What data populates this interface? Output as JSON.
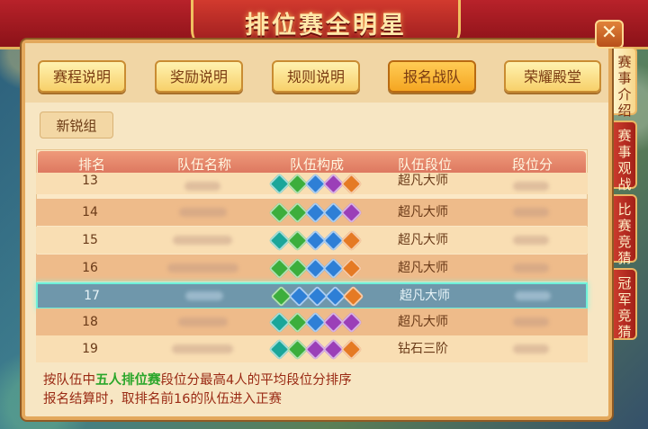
{
  "window": {
    "title": "排位赛全明星",
    "close_label": "✕"
  },
  "tabs": [
    {
      "label": "赛程说明",
      "active": false
    },
    {
      "label": "奖励说明",
      "active": false
    },
    {
      "label": "规则说明",
      "active": false
    },
    {
      "label": "报名战队",
      "active": true
    },
    {
      "label": "荣耀殿堂",
      "active": false
    }
  ],
  "group_button": "新锐组",
  "side_tabs": [
    {
      "label": "赛事介绍",
      "active": true
    },
    {
      "label": "赛事观战",
      "active": false
    },
    {
      "label": "比赛竞猜",
      "active": false
    },
    {
      "label": "冠军竞猜",
      "active": false
    }
  ],
  "table": {
    "headers": [
      "排名",
      "队伍名称",
      "队伍构成",
      "队伍段位",
      "段位分"
    ],
    "rows": [
      {
        "rank": "13",
        "tier": "超凡大师",
        "heroes": [
          "teal",
          "green",
          "blue",
          "purple",
          "orange"
        ],
        "selected": false
      },
      {
        "rank": "14",
        "tier": "超凡大师",
        "heroes": [
          "green",
          "green",
          "blue",
          "blue",
          "purple"
        ],
        "selected": false
      },
      {
        "rank": "15",
        "tier": "超凡大师",
        "heroes": [
          "teal",
          "green",
          "blue",
          "blue",
          "orange"
        ],
        "selected": false
      },
      {
        "rank": "16",
        "tier": "超凡大师",
        "heroes": [
          "green",
          "green",
          "blue",
          "blue",
          "orange"
        ],
        "selected": false
      },
      {
        "rank": "17",
        "tier": "超凡大师",
        "heroes": [
          "green",
          "blue",
          "blue",
          "blue",
          "orange"
        ],
        "selected": true
      },
      {
        "rank": "18",
        "tier": "超凡大师",
        "heroes": [
          "teal",
          "green",
          "blue",
          "purple",
          "purple"
        ],
        "selected": false
      },
      {
        "rank": "19",
        "tier": "钻石三阶",
        "heroes": [
          "teal",
          "green",
          "purple",
          "purple",
          "orange"
        ],
        "selected": false
      }
    ]
  },
  "notes": {
    "line1_pre": "按队伍中",
    "line1_highlight": "五人排位赛",
    "line1_post": "段位分最高4人的平均段位分排序",
    "line2": "报名结算时，取排名前16的队伍进入正赛"
  },
  "colors": {
    "accent": "#f5a622",
    "banner": "#b8222a",
    "selected_row": "#6f97ab",
    "highlight_text": "#2aa62a"
  }
}
